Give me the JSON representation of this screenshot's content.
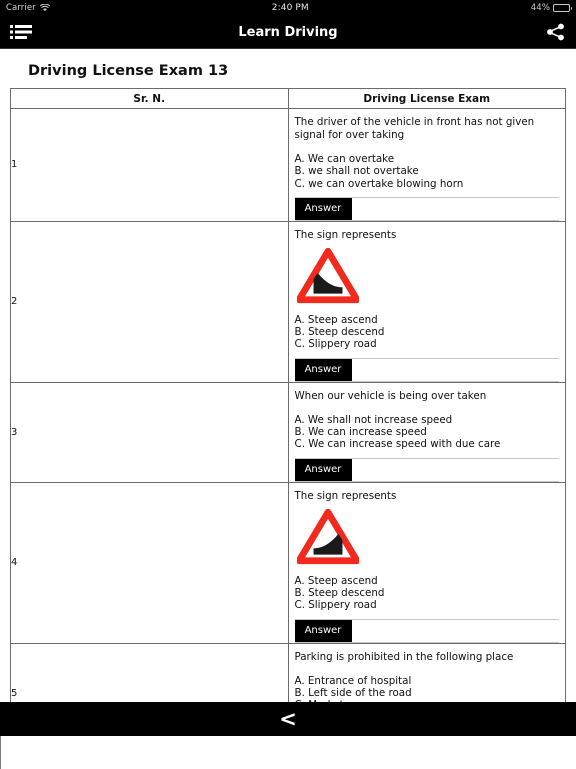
{
  "status_bar": {
    "carrier": "Carrier",
    "wifi_icon": "wifi-icon",
    "time": "2:40 PM",
    "battery_percent": "44%",
    "battery_level": 44
  },
  "nav_bar": {
    "menu_icon": "list-menu-icon",
    "title": "Learn Driving",
    "share_icon": "share-icon"
  },
  "page": {
    "title": "Driving License Exam 13"
  },
  "table": {
    "headers": {
      "sr_no": "Sr. N.",
      "exam": "Driving License Exam"
    },
    "answer_label": "Answer",
    "rows": [
      {
        "sr_no": "1",
        "question": "The driver of the vehicle in front has not given signal for over taking",
        "has_sign": false,
        "sign_type": "",
        "options": [
          "A. We can overtake",
          "B. we shall not overtake",
          "C. we can overtake blowing horn"
        ]
      },
      {
        "sr_no": "2",
        "question": "The sign represents",
        "has_sign": true,
        "sign_type": "steep-ascend-warning-sign",
        "options": [
          "A. Steep ascend",
          "B. Steep descend",
          "C. Slippery road"
        ]
      },
      {
        "sr_no": "3",
        "question": "When our vehicle is being over taken",
        "has_sign": false,
        "sign_type": "",
        "options": [
          "A. We shall not increase speed",
          "B. We can increase speed",
          "C. We can increase speed with due care"
        ]
      },
      {
        "sr_no": "4",
        "question": "The sign represents",
        "has_sign": true,
        "sign_type": "steep-descend-warning-sign",
        "options": [
          "A. Steep ascend",
          "B. Steep descend",
          "C. Slippery road"
        ]
      },
      {
        "sr_no": "5",
        "question": "Parking is prohibited in the following place",
        "has_sign": false,
        "sign_type": "",
        "options": [
          "A. Entrance of hospital",
          "B. Left side of the road",
          "C. Market area"
        ]
      }
    ]
  },
  "bottom_bar": {
    "back_icon": "back-chevron-icon",
    "back_label": "<"
  },
  "colors": {
    "bar_background": "#000000",
    "sign_red": "#f22a1e",
    "sign_dark": "#1a1a1a",
    "table_border": "#6b6b6b",
    "answer_button": "#000000"
  }
}
